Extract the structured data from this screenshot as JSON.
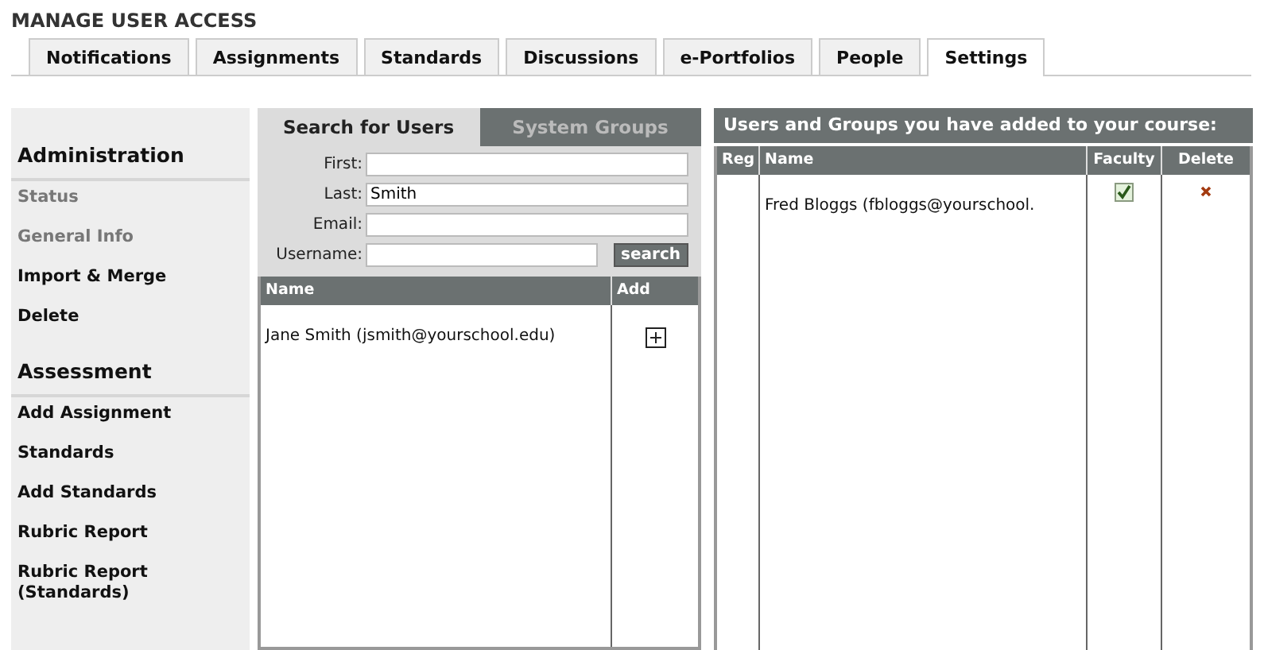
{
  "page_title": "MANAGE USER ACCESS",
  "tabs": [
    {
      "label": "Notifications",
      "selected": false
    },
    {
      "label": "Assignments",
      "selected": false
    },
    {
      "label": "Standards",
      "selected": false
    },
    {
      "label": "Discussions",
      "selected": false
    },
    {
      "label": "e-Portfolios",
      "selected": false
    },
    {
      "label": "People",
      "selected": false
    },
    {
      "label": "Settings",
      "selected": true
    }
  ],
  "sidebar": {
    "sections": [
      {
        "heading": "Administration",
        "items": [
          {
            "label": "Status",
            "disabled": true
          },
          {
            "label": "General Info",
            "disabled": true
          },
          {
            "label": "Import & Merge",
            "disabled": false
          },
          {
            "label": "Delete",
            "disabled": false
          }
        ]
      },
      {
        "heading": "Assessment",
        "items": [
          {
            "label": "Add Assignment",
            "disabled": false
          },
          {
            "label": "Standards",
            "disabled": false
          },
          {
            "label": "Add Standards",
            "disabled": false
          },
          {
            "label": "Rubric Report",
            "disabled": false
          },
          {
            "label": "Rubric Report\n(Standards)",
            "disabled": false
          }
        ]
      }
    ]
  },
  "search_panel": {
    "tabs": [
      {
        "label": "Search for Users",
        "selected": true
      },
      {
        "label": "System Groups",
        "selected": false
      }
    ],
    "fields": [
      {
        "label": "First:"
      },
      {
        "label": "Last:",
        "value": "Smith"
      },
      {
        "label": "Email:"
      },
      {
        "label": "Username:"
      }
    ],
    "search_button": "search",
    "table": {
      "columns": [
        "Name",
        "Add"
      ],
      "rows": [
        {
          "name": "Jane Smith (jsmith@yourschool.edu)"
        }
      ]
    }
  },
  "added_panel": {
    "title": "Users and Groups you have added to your course:",
    "table": {
      "columns": [
        "Reg",
        "Name",
        "Faculty",
        "Delete"
      ],
      "rows": [
        {
          "name": "Fred Bloggs (fbloggs@yourschool.",
          "faculty": true
        }
      ]
    }
  }
}
